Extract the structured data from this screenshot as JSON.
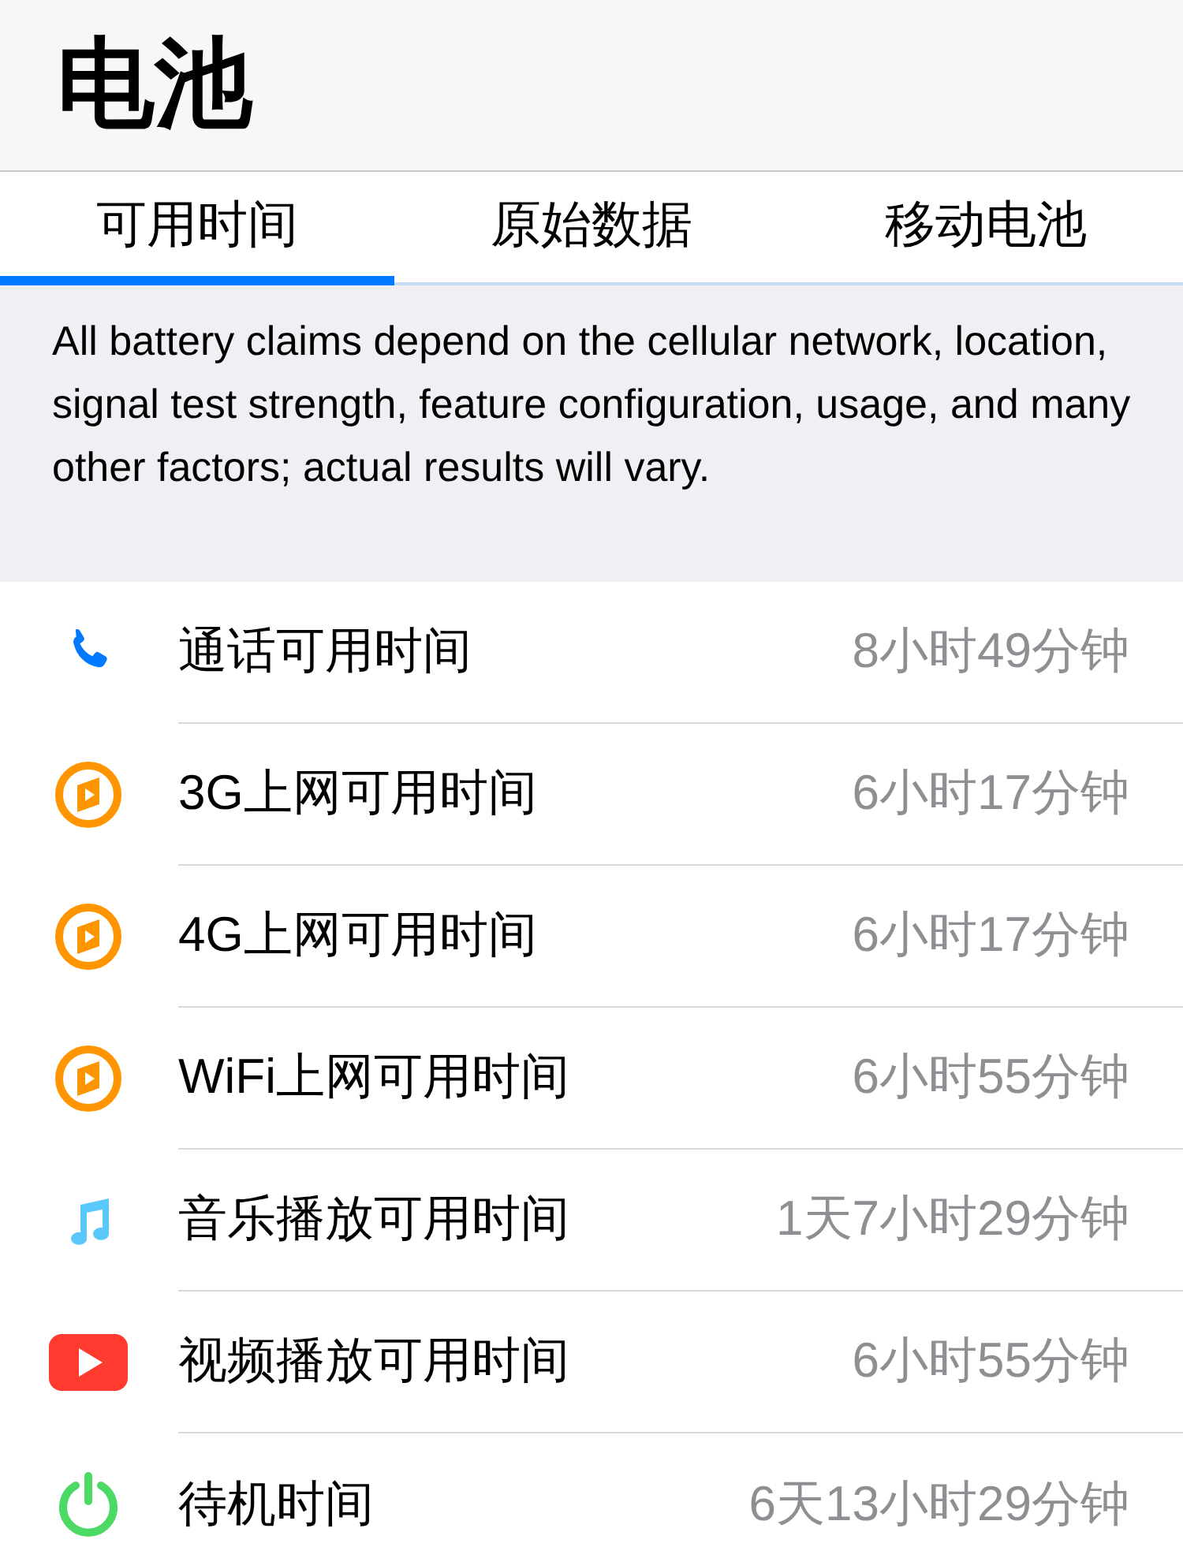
{
  "header": {
    "title": "电池"
  },
  "tabs": [
    {
      "label": "可用时间",
      "selected": true
    },
    {
      "label": "原始数据",
      "selected": false
    },
    {
      "label": "移动电池",
      "selected": false
    }
  ],
  "notice": "All battery claims depend on the cellular network, location, signal test strength, feature configuration, usage, and many other factors; actual results will vary.",
  "rows": [
    {
      "kind": "phone",
      "label": "通话可用时间",
      "value": "8小时49分钟"
    },
    {
      "kind": "browser",
      "label": "3G上网可用时间",
      "value": "6小时17分钟"
    },
    {
      "kind": "browser",
      "label": "4G上网可用时间",
      "value": "6小时17分钟"
    },
    {
      "kind": "browser",
      "label": "WiFi上网可用时间",
      "value": "6小时55分钟"
    },
    {
      "kind": "music",
      "label": "音乐播放可用时间",
      "value": "1天7小时29分钟"
    },
    {
      "kind": "video",
      "label": "视频播放可用时间",
      "value": "6小时55分钟"
    },
    {
      "kind": "standby",
      "label": "待机时间",
      "value": "6天13小时29分钟"
    }
  ]
}
